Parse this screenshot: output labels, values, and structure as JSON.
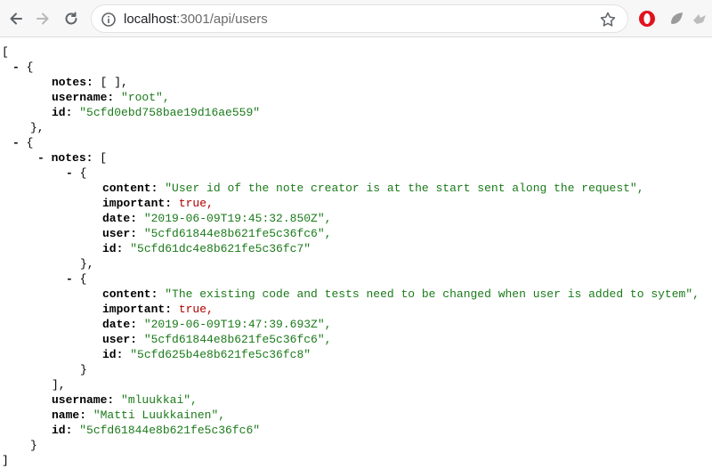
{
  "browser": {
    "url_host": "localhost",
    "url_path": ":3001/api/users"
  },
  "json_view": {
    "toggle": "-",
    "open_bracket": "[",
    "close_bracket": "]",
    "open_brace": "{",
    "close_brace": "}",
    "close_brace_comma": "},",
    "close_bracket_comma": "],",
    "empty_array": "[ ],",
    "keys": {
      "notes": "notes:",
      "username": "username:",
      "id": "id:",
      "content": "content:",
      "important": "important:",
      "date": "date:",
      "user": "user:",
      "name": "name:"
    },
    "users": [
      {
        "username": "\"root\",",
        "id": "\"5cfd0ebd758bae19d16ae559\""
      },
      {
        "notes": [
          {
            "content": "\"User id of the note creator is at the start sent along the request\",",
            "important": "true,",
            "date": "\"2019-06-09T19:45:32.850Z\",",
            "user": "\"5cfd61844e8b621fe5c36fc6\",",
            "id": "\"5cfd61dc4e8b621fe5c36fc7\""
          },
          {
            "content": "\"The existing code and tests need to be changed when user is added to sytem\",",
            "important": "true,",
            "date": "\"2019-06-09T19:47:39.693Z\",",
            "user": "\"5cfd61844e8b621fe5c36fc6\",",
            "id": "\"5cfd625b4e8b621fe5c36fc8\""
          }
        ],
        "username": "\"mluukkai\",",
        "name": "\"Matti Luukkainen\",",
        "id": "\"5cfd61844e8b621fe5c36fc6\""
      }
    ]
  },
  "colors": {
    "string": "#1a7a1a",
    "boolean": "#b00000"
  }
}
